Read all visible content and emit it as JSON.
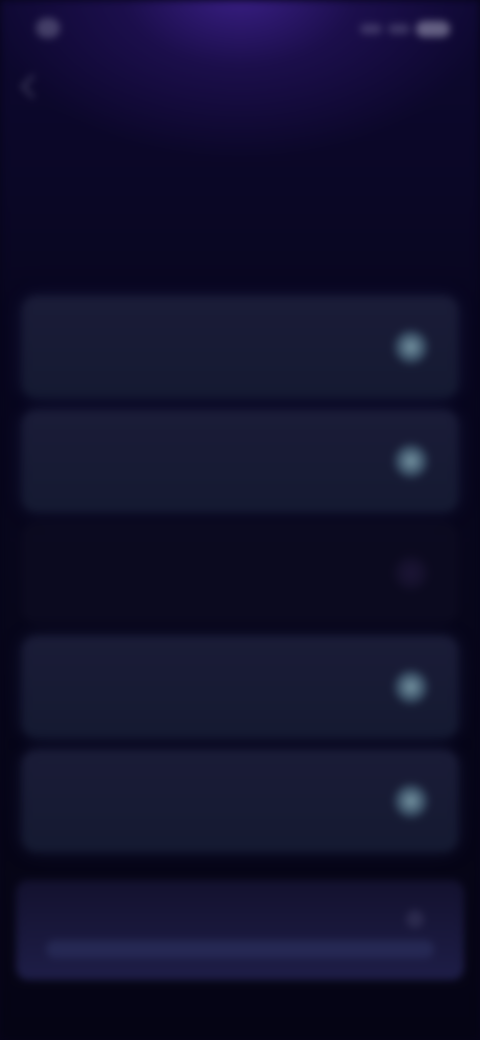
{
  "status_bar": {
    "icons": [
      "signal-icon",
      "wifi-icon",
      "battery-icon"
    ]
  },
  "header": {
    "back_icon": "chevron-left-icon",
    "title": ""
  },
  "intro": {
    "kicker": "",
    "headline": ""
  },
  "settings": {
    "items": [
      {
        "label": "",
        "enabled": true
      },
      {
        "label": "",
        "enabled": true
      },
      {
        "label": "",
        "enabled": false
      },
      {
        "label": "",
        "enabled": true
      },
      {
        "label": "",
        "enabled": true
      }
    ]
  },
  "footer": {
    "label": "",
    "icon": "info-icon"
  },
  "colors": {
    "background": "#07051a",
    "glow": "#3a1f86",
    "card": "#1c1e3a",
    "toggle_on": "#96bec8"
  }
}
